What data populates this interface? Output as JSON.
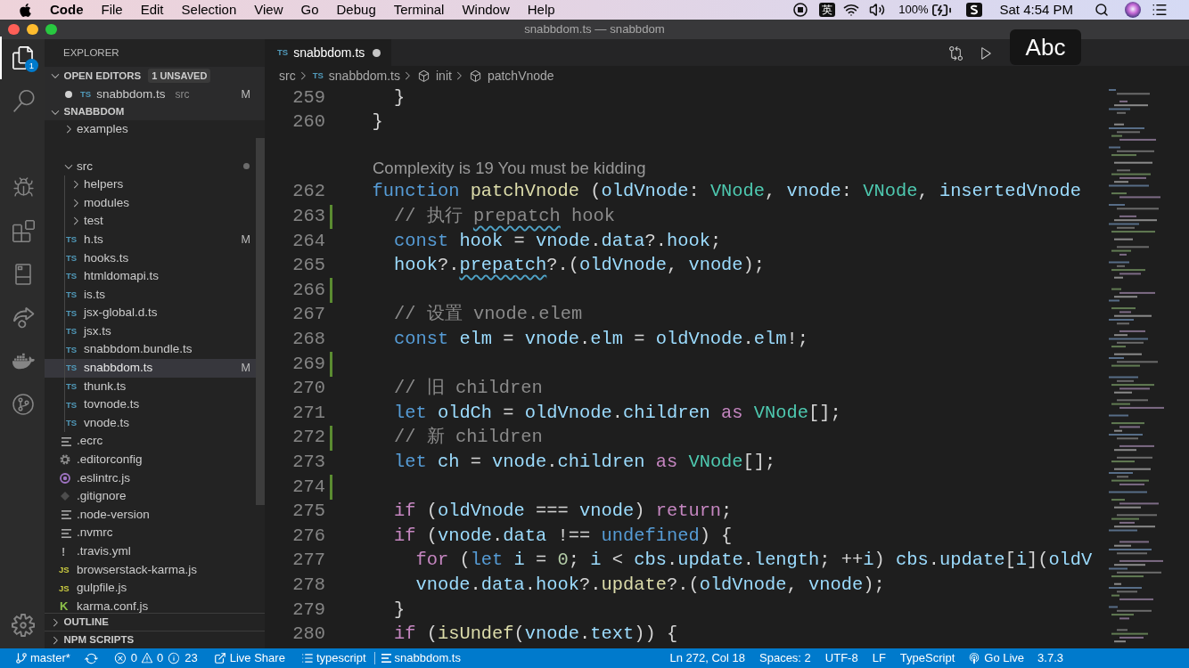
{
  "menubar": {
    "app": "Code",
    "menus": [
      "File",
      "Edit",
      "Selection",
      "View",
      "Go",
      "Debug",
      "Terminal",
      "Window",
      "Help"
    ],
    "input_source": "英",
    "battery": "100%",
    "clock": "Sat 4:54 PM"
  },
  "window": {
    "title": "snabbdom.ts — snabbdom"
  },
  "activity_bar": {
    "items": [
      {
        "kind": "explorer",
        "selected": true,
        "badge": "1"
      },
      {
        "kind": "search",
        "selected": false
      },
      {
        "kind": "debug",
        "selected": false
      },
      {
        "kind": "extensions",
        "selected": false
      },
      {
        "kind": "panel",
        "selected": false
      },
      {
        "kind": "share",
        "selected": false
      },
      {
        "kind": "docker",
        "selected": false
      },
      {
        "kind": "graph",
        "selected": false
      }
    ],
    "bottom": [
      {
        "kind": "settings",
        "selected": false
      }
    ]
  },
  "sidebar": {
    "title": "EXPLORER",
    "open_editors": {
      "title": "OPEN EDITORS",
      "expanded": true,
      "badge": "1 UNSAVED",
      "items": [
        {
          "kind": "ts",
          "icon_label": "TS",
          "name": "snabbdom.ts",
          "description": "src",
          "dirty": true,
          "status": "M"
        }
      ]
    },
    "workspace": {
      "title": "SNABBDOM",
      "expanded": true,
      "tree": [
        {
          "kind": "folder",
          "name": "examples",
          "expanded": false,
          "selected": false
        },
        {
          "kind": "folder",
          "name": "src",
          "expanded": true,
          "selected": false,
          "children": [
            {
              "kind": "folder",
              "name": "helpers",
              "expanded": false,
              "selected": false
            },
            {
              "kind": "folder",
              "name": "modules",
              "expanded": false,
              "selected": false
            },
            {
              "kind": "folder",
              "name": "test",
              "expanded": false,
              "selected": false
            },
            {
              "kind": "ts",
              "icon_label": "TS",
              "name": "h.ts",
              "status": "M",
              "selected": false
            },
            {
              "kind": "ts",
              "icon_label": "TS",
              "name": "hooks.ts",
              "selected": false
            },
            {
              "kind": "ts",
              "icon_label": "TS",
              "name": "htmldomapi.ts",
              "selected": false
            },
            {
              "kind": "ts",
              "icon_label": "TS",
              "name": "is.ts",
              "selected": false
            },
            {
              "kind": "ts",
              "icon_label": "TS",
              "name": "jsx-global.d.ts",
              "selected": false
            },
            {
              "kind": "ts",
              "icon_label": "TS",
              "name": "jsx.ts",
              "selected": false
            },
            {
              "kind": "ts",
              "icon_label": "TS",
              "name": "snabbdom.bundle.ts",
              "selected": false
            },
            {
              "kind": "ts",
              "icon_label": "TS",
              "name": "snabbdom.ts",
              "status": "M",
              "selected": true
            },
            {
              "kind": "ts",
              "icon_label": "TS",
              "name": "thunk.ts",
              "selected": false
            },
            {
              "kind": "ts",
              "icon_label": "TS",
              "name": "tovnode.ts",
              "selected": false
            },
            {
              "kind": "ts",
              "icon_label": "TS",
              "name": "vnode.ts",
              "selected": false
            }
          ]
        },
        {
          "kind": "text",
          "name": ".ecrc",
          "selected": false
        },
        {
          "kind": "config",
          "name": ".editorconfig",
          "selected": false
        },
        {
          "kind": "eslint",
          "name": ".eslintrc.js",
          "selected": false
        },
        {
          "kind": "git",
          "name": ".gitignore",
          "selected": false
        },
        {
          "kind": "text",
          "name": ".node-version",
          "selected": false
        },
        {
          "kind": "text",
          "name": ".nvmrc",
          "selected": false
        },
        {
          "kind": "yaml",
          "icon_label": "!",
          "name": ".travis.yml",
          "selected": false
        },
        {
          "kind": "js",
          "icon_label": "JS",
          "name": "browserstack-karma.js",
          "selected": false
        },
        {
          "kind": "js",
          "icon_label": "JS",
          "name": "gulpfile.js",
          "selected": false
        },
        {
          "kind": "karma",
          "icon_label": "K",
          "name": "karma.conf.js",
          "selected": false
        }
      ]
    },
    "sections": [
      {
        "title": "OUTLINE",
        "expanded": false
      },
      {
        "title": "NPM SCRIPTS",
        "expanded": false
      }
    ]
  },
  "editor": {
    "tab": {
      "icon_label": "TS",
      "name": "snabbdom.ts",
      "dirty": true,
      "selected": true
    },
    "actions": [
      {
        "kind": "compare"
      },
      {
        "kind": "run"
      }
    ],
    "breadcrumbs": [
      {
        "kind": "folder",
        "text": "src"
      },
      {
        "kind": "file",
        "icon_label": "TS",
        "text": "snabbdom.ts"
      },
      {
        "kind": "symbol",
        "text": "init"
      },
      {
        "kind": "symbol",
        "text": "patchVnode"
      }
    ],
    "lines": [
      {
        "kind": "code",
        "number": "259",
        "added": false,
        "tokens": [
          {
            "kind": "plain",
            "text": "    }"
          }
        ]
      },
      {
        "kind": "code",
        "number": "260",
        "added": false,
        "tokens": [
          {
            "kind": "plain",
            "text": "  }"
          }
        ]
      },
      {
        "kind": "codelens",
        "text": "Complexity is 19 You must be kidding"
      },
      {
        "kind": "code",
        "number": "262",
        "added": false,
        "tokens": [
          {
            "kind": "keyword",
            "text": "  function"
          },
          {
            "kind": "function",
            "text": " patchVnode"
          },
          {
            "kind": "plain",
            "text": " ("
          },
          {
            "kind": "variable",
            "text": "oldVnode"
          },
          {
            "kind": "plain",
            "text": ": "
          },
          {
            "kind": "type",
            "text": "VNode"
          },
          {
            "kind": "plain",
            "text": ", "
          },
          {
            "kind": "variable",
            "text": "vnode"
          },
          {
            "kind": "plain",
            "text": ": "
          },
          {
            "kind": "type",
            "text": "VNode"
          },
          {
            "kind": "plain",
            "text": ", "
          },
          {
            "kind": "variable",
            "text": "insertedVnode"
          }
        ]
      },
      {
        "kind": "code",
        "number": "263",
        "added": true,
        "tokens": [
          {
            "kind": "comment",
            "text": "    // 执行 "
          },
          {
            "kind": "typocomment",
            "text": "prepatch"
          },
          {
            "kind": "comment",
            "text": " hook"
          }
        ]
      },
      {
        "kind": "code",
        "number": "264",
        "added": false,
        "tokens": [
          {
            "kind": "keyword",
            "text": "    const"
          },
          {
            "kind": "variable",
            "text": " hook"
          },
          {
            "kind": "plain",
            "text": " = "
          },
          {
            "kind": "variable",
            "text": "vnode"
          },
          {
            "kind": "plain",
            "text": "."
          },
          {
            "kind": "variable",
            "text": "data"
          },
          {
            "kind": "plain",
            "text": "?."
          },
          {
            "kind": "variable",
            "text": "hook"
          },
          {
            "kind": "plain",
            "text": ";"
          }
        ]
      },
      {
        "kind": "code",
        "number": "265",
        "added": false,
        "tokens": [
          {
            "kind": "variable",
            "text": "    hook"
          },
          {
            "kind": "plain",
            "text": "?."
          },
          {
            "kind": "typovariable",
            "text": "prepatch"
          },
          {
            "kind": "plain",
            "text": "?.("
          },
          {
            "kind": "variable",
            "text": "oldVnode"
          },
          {
            "kind": "plain",
            "text": ", "
          },
          {
            "kind": "variable",
            "text": "vnode"
          },
          {
            "kind": "plain",
            "text": ");"
          }
        ]
      },
      {
        "kind": "code",
        "number": "266",
        "added": true
      },
      {
        "kind": "code",
        "number": "267",
        "added": false,
        "tokens": [
          {
            "kind": "comment",
            "text": "    // 设置 vnode.elem"
          }
        ]
      },
      {
        "kind": "code",
        "number": "268",
        "added": false,
        "tokens": [
          {
            "kind": "keyword",
            "text": "    const"
          },
          {
            "kind": "variable",
            "text": " elm"
          },
          {
            "kind": "plain",
            "text": " = "
          },
          {
            "kind": "variable",
            "text": "vnode"
          },
          {
            "kind": "plain",
            "text": "."
          },
          {
            "kind": "variable",
            "text": "elm"
          },
          {
            "kind": "plain",
            "text": " = "
          },
          {
            "kind": "variable",
            "text": "oldVnode"
          },
          {
            "kind": "plain",
            "text": "."
          },
          {
            "kind": "variable",
            "text": "elm"
          },
          {
            "kind": "plain",
            "text": "!;"
          }
        ]
      },
      {
        "kind": "code",
        "number": "269",
        "added": true
      },
      {
        "kind": "code",
        "number": "270",
        "added": false,
        "tokens": [
          {
            "kind": "comment",
            "text": "    // 旧 children"
          }
        ]
      },
      {
        "kind": "code",
        "number": "271",
        "added": false,
        "tokens": [
          {
            "kind": "keyword",
            "text": "    let"
          },
          {
            "kind": "variable",
            "text": " oldCh"
          },
          {
            "kind": "plain",
            "text": " = "
          },
          {
            "kind": "variable",
            "text": "oldVnode"
          },
          {
            "kind": "plain",
            "text": "."
          },
          {
            "kind": "variable",
            "text": "children"
          },
          {
            "kind": "control",
            "text": " as"
          },
          {
            "kind": "type",
            "text": " VNode"
          },
          {
            "kind": "plain",
            "text": "[];"
          }
        ]
      },
      {
        "kind": "code",
        "number": "272",
        "added": true,
        "tokens": [
          {
            "kind": "comment",
            "text": "    // 新 children"
          }
        ]
      },
      {
        "kind": "code",
        "number": "273",
        "added": false,
        "tokens": [
          {
            "kind": "keyword",
            "text": "    let"
          },
          {
            "kind": "variable",
            "text": " ch"
          },
          {
            "kind": "plain",
            "text": " = "
          },
          {
            "kind": "variable",
            "text": "vnode"
          },
          {
            "kind": "plain",
            "text": "."
          },
          {
            "kind": "variable",
            "text": "children"
          },
          {
            "kind": "control",
            "text": " as"
          },
          {
            "kind": "type",
            "text": " VNode"
          },
          {
            "kind": "plain",
            "text": "[];"
          }
        ]
      },
      {
        "kind": "code",
        "number": "274",
        "added": true
      },
      {
        "kind": "code",
        "number": "275",
        "added": false,
        "tokens": [
          {
            "kind": "control",
            "text": "    if"
          },
          {
            "kind": "plain",
            "text": " ("
          },
          {
            "kind": "variable",
            "text": "oldVnode"
          },
          {
            "kind": "plain",
            "text": " === "
          },
          {
            "kind": "variable",
            "text": "vnode"
          },
          {
            "kind": "plain",
            "text": ") "
          },
          {
            "kind": "control",
            "text": "return"
          },
          {
            "kind": "plain",
            "text": ";"
          }
        ]
      },
      {
        "kind": "code",
        "number": "276",
        "added": false,
        "tokens": [
          {
            "kind": "control",
            "text": "    if"
          },
          {
            "kind": "plain",
            "text": " ("
          },
          {
            "kind": "variable",
            "text": "vnode"
          },
          {
            "kind": "plain",
            "text": "."
          },
          {
            "kind": "variable",
            "text": "data"
          },
          {
            "kind": "plain",
            "text": " !== "
          },
          {
            "kind": "keyword",
            "text": "undefined"
          },
          {
            "kind": "plain",
            "text": ") {"
          }
        ]
      },
      {
        "kind": "code",
        "number": "277",
        "added": false,
        "tokens": [
          {
            "kind": "control",
            "text": "      for"
          },
          {
            "kind": "plain",
            "text": " ("
          },
          {
            "kind": "keyword",
            "text": "let"
          },
          {
            "kind": "variable",
            "text": " i"
          },
          {
            "kind": "plain",
            "text": " = "
          },
          {
            "kind": "number",
            "text": "0"
          },
          {
            "kind": "plain",
            "text": "; "
          },
          {
            "kind": "variable",
            "text": "i"
          },
          {
            "kind": "plain",
            "text": " < "
          },
          {
            "kind": "variable",
            "text": "cbs"
          },
          {
            "kind": "plain",
            "text": "."
          },
          {
            "kind": "variable",
            "text": "update"
          },
          {
            "kind": "plain",
            "text": "."
          },
          {
            "kind": "variable",
            "text": "length"
          },
          {
            "kind": "plain",
            "text": "; ++"
          },
          {
            "kind": "variable",
            "text": "i"
          },
          {
            "kind": "plain",
            "text": ") "
          },
          {
            "kind": "variable",
            "text": "cbs"
          },
          {
            "kind": "plain",
            "text": "."
          },
          {
            "kind": "variable",
            "text": "update"
          },
          {
            "kind": "plain",
            "text": "["
          },
          {
            "kind": "variable",
            "text": "i"
          },
          {
            "kind": "plain",
            "text": "]("
          },
          {
            "kind": "variable",
            "text": "oldV"
          }
        ]
      },
      {
        "kind": "code",
        "number": "278",
        "added": false,
        "tokens": [
          {
            "kind": "variable",
            "text": "      vnode"
          },
          {
            "kind": "plain",
            "text": "."
          },
          {
            "kind": "variable",
            "text": "data"
          },
          {
            "kind": "plain",
            "text": "."
          },
          {
            "kind": "variable",
            "text": "hook"
          },
          {
            "kind": "plain",
            "text": "?."
          },
          {
            "kind": "function",
            "text": "update"
          },
          {
            "kind": "plain",
            "text": "?.("
          },
          {
            "kind": "variable",
            "text": "oldVnode"
          },
          {
            "kind": "plain",
            "text": ", "
          },
          {
            "kind": "variable",
            "text": "vnode"
          },
          {
            "kind": "plain",
            "text": ");"
          }
        ]
      },
      {
        "kind": "code",
        "number": "279",
        "added": false,
        "tokens": [
          {
            "kind": "plain",
            "text": "    }"
          }
        ]
      },
      {
        "kind": "code",
        "number": "280",
        "added": false,
        "tokens": [
          {
            "kind": "control",
            "text": "    if"
          },
          {
            "kind": "plain",
            "text": " ("
          },
          {
            "kind": "function",
            "text": "isUndef"
          },
          {
            "kind": "plain",
            "text": "("
          },
          {
            "kind": "variable",
            "text": "vnode"
          },
          {
            "kind": "plain",
            "text": "."
          },
          {
            "kind": "variable",
            "text": "text"
          },
          {
            "kind": "plain",
            "text": ")) {"
          }
        ]
      }
    ]
  },
  "input_popup": {
    "text": "Abc"
  },
  "status_bar": {
    "left": [
      {
        "kind": "branch",
        "text": "master*"
      },
      {
        "kind": "sync"
      },
      {
        "kind": "problems",
        "errors": "0",
        "warnings": "0",
        "info": "23"
      },
      {
        "kind": "liveshare",
        "text": "Live Share"
      },
      {
        "kind": "language",
        "text": "typescript"
      },
      {
        "kind": "file",
        "text": "snabbdom.ts"
      }
    ],
    "right": [
      {
        "kind": "position",
        "text": "Ln 272, Col 18"
      },
      {
        "kind": "indent",
        "text": "Spaces: 2"
      },
      {
        "kind": "encoding",
        "text": "UTF-8"
      },
      {
        "kind": "eol",
        "text": "LF"
      },
      {
        "kind": "mode",
        "text": "TypeScript"
      },
      {
        "kind": "golive",
        "text": "Go Live"
      },
      {
        "kind": "version",
        "text": "3.7.3"
      }
    ]
  }
}
